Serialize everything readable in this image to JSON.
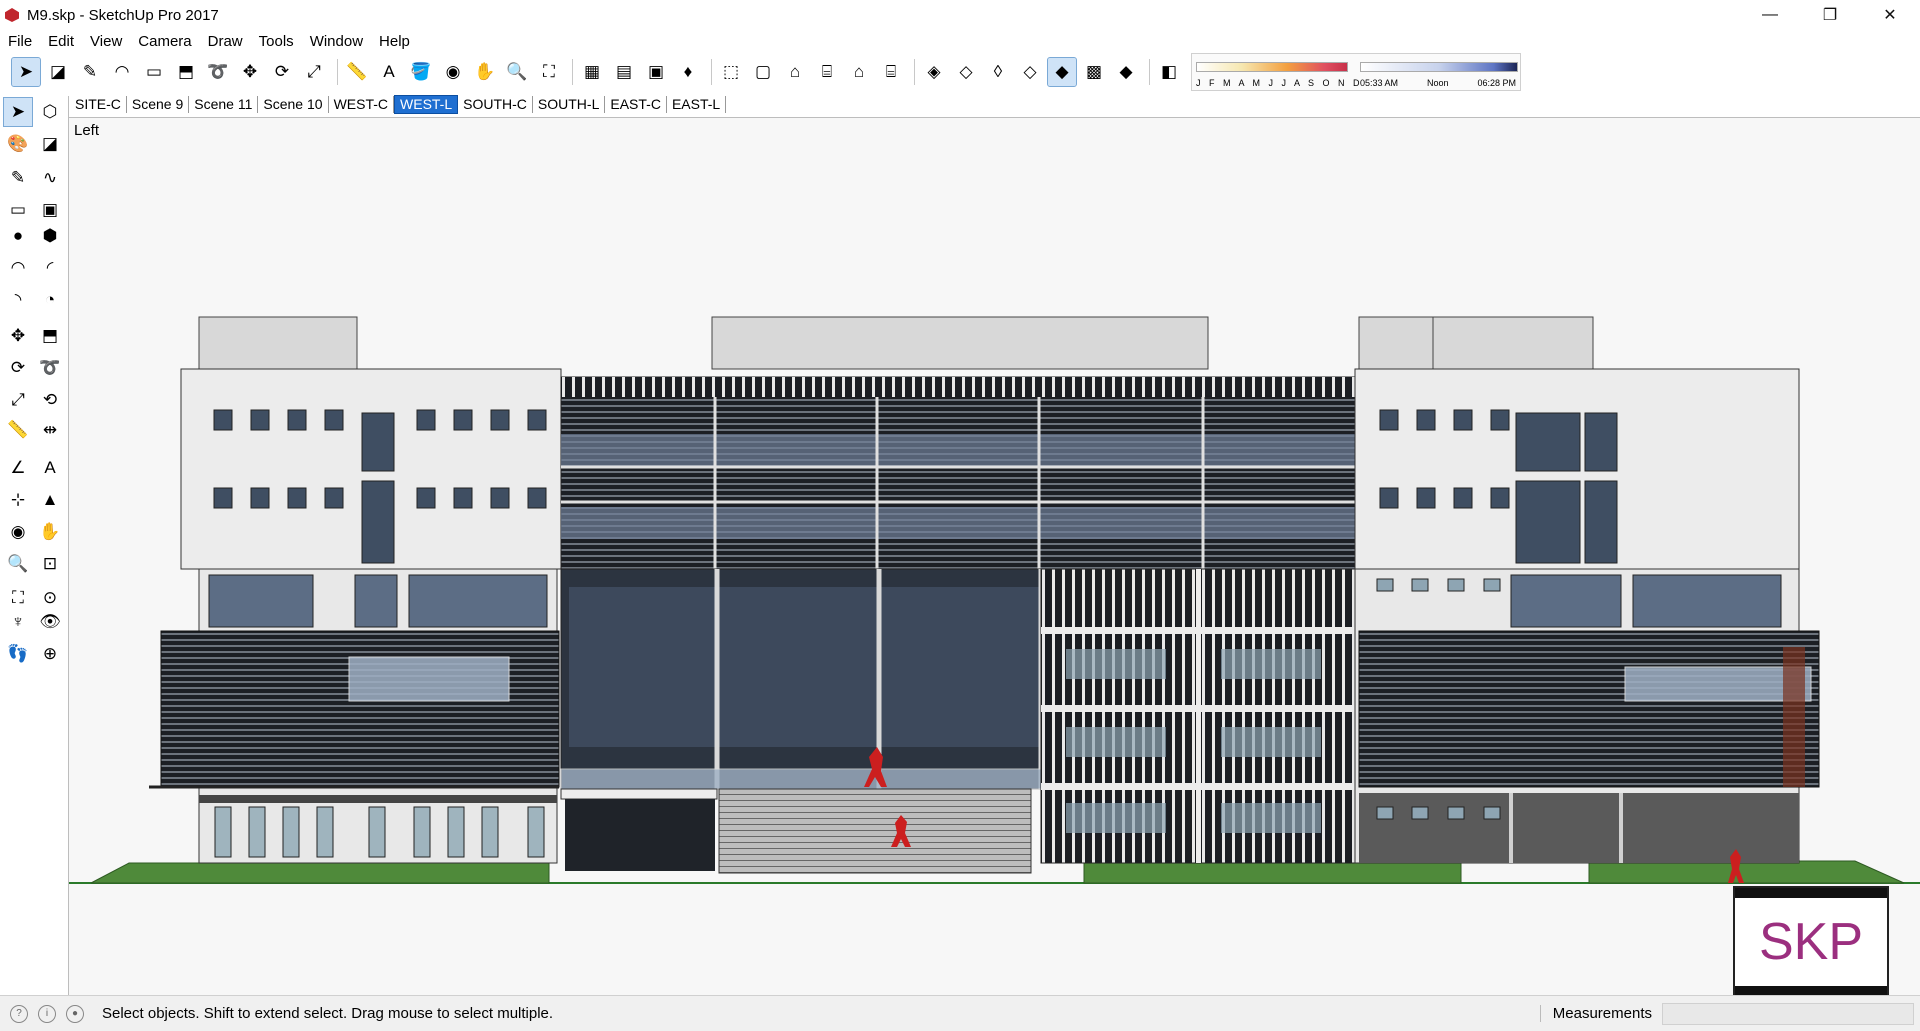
{
  "window": {
    "title": "M9.skp - SketchUp Pro 2017",
    "controls": {
      "minimize": "—",
      "maximize": "❐",
      "close": "✕"
    }
  },
  "menu": [
    "File",
    "Edit",
    "View",
    "Camera",
    "Draw",
    "Tools",
    "Window",
    "Help"
  ],
  "toolbar": {
    "tools": [
      {
        "name": "select-icon",
        "glyph": "➤",
        "active": true
      },
      {
        "name": "eraser-icon",
        "glyph": "◪"
      },
      {
        "name": "pencil-icon",
        "glyph": "✎"
      },
      {
        "name": "arc-icon",
        "glyph": "◠"
      },
      {
        "name": "rectangle-icon",
        "glyph": "▭"
      },
      {
        "name": "push-pull-icon",
        "glyph": "⬒"
      },
      {
        "name": "follow-me-icon",
        "glyph": "➰"
      },
      {
        "name": "move-icon",
        "glyph": "✥"
      },
      {
        "name": "rotate-icon",
        "glyph": "⟳"
      },
      {
        "name": "scale-icon",
        "glyph": "⤢"
      },
      {
        "name": "tape-measure-icon",
        "glyph": "📏"
      },
      {
        "name": "text-icon",
        "glyph": "A"
      },
      {
        "name": "paint-bucket-icon",
        "glyph": "🪣"
      },
      {
        "name": "orbit-icon",
        "glyph": "◉"
      },
      {
        "name": "pan-icon",
        "glyph": "✋"
      },
      {
        "name": "zoom-icon",
        "glyph": "🔍"
      },
      {
        "name": "zoom-extents-icon",
        "glyph": "⛶"
      },
      {
        "name": "warehouse-icon",
        "glyph": "▦"
      },
      {
        "name": "share-model-icon",
        "glyph": "▤"
      },
      {
        "name": "extension-warehouse-icon",
        "glyph": "▣"
      },
      {
        "name": "ruby-icon",
        "glyph": "♦"
      },
      {
        "name": "iso-view-icon",
        "glyph": "⬚"
      },
      {
        "name": "top-view-icon",
        "glyph": "▢"
      },
      {
        "name": "front-view-icon",
        "glyph": "⌂"
      },
      {
        "name": "right-view-icon",
        "glyph": "⌸"
      },
      {
        "name": "back-view-icon",
        "glyph": "⌂"
      },
      {
        "name": "left-view-icon",
        "glyph": "⌸"
      },
      {
        "name": "xray-icon",
        "glyph": "◈"
      },
      {
        "name": "back-edges-icon",
        "glyph": "◇"
      },
      {
        "name": "wireframe-icon",
        "glyph": "◊"
      },
      {
        "name": "hidden-line-icon",
        "glyph": "◇"
      },
      {
        "name": "shaded-icon",
        "glyph": "◆",
        "active": true
      },
      {
        "name": "shaded-textures-icon",
        "glyph": "▩"
      },
      {
        "name": "monochrome-icon",
        "glyph": "◆"
      },
      {
        "name": "shadows-icon",
        "glyph": "◧"
      }
    ],
    "shadow_months": "J F M A M J J A S O N D",
    "shadow_times": {
      "start": "05:33 AM",
      "mid": "Noon",
      "end": "06:28 PM"
    }
  },
  "left_toolbar": [
    {
      "name": "select-icon",
      "glyph": "➤",
      "active": true
    },
    {
      "name": "make-component-icon",
      "glyph": "⬡"
    },
    {
      "name": "paint-bucket-icon",
      "glyph": "🎨"
    },
    {
      "name": "eraser-icon",
      "glyph": "◪"
    },
    {
      "name": "line-icon",
      "glyph": "✎"
    },
    {
      "name": "freehand-icon",
      "glyph": "∿"
    },
    {
      "name": "rectangle-icon",
      "glyph": "▭"
    },
    {
      "name": "rotated-rectangle-icon",
      "glyph": "▣"
    },
    {
      "name": "circle-icon",
      "glyph": "●"
    },
    {
      "name": "polygon-icon",
      "glyph": "⬢"
    },
    {
      "name": "arc-icon",
      "glyph": "◠"
    },
    {
      "name": "two-point-arc-icon",
      "glyph": "◜"
    },
    {
      "name": "three-point-arc-icon",
      "glyph": "◝"
    },
    {
      "name": "pie-icon",
      "glyph": "◔"
    },
    {
      "name": "move-icon",
      "glyph": "✥"
    },
    {
      "name": "push-pull-icon",
      "glyph": "⬒"
    },
    {
      "name": "rotate-icon",
      "glyph": "⟳"
    },
    {
      "name": "follow-me-icon",
      "glyph": "➰"
    },
    {
      "name": "scale-icon",
      "glyph": "⤢"
    },
    {
      "name": "offset-icon",
      "glyph": "⟲"
    },
    {
      "name": "tape-measure-icon",
      "glyph": "📏"
    },
    {
      "name": "dimension-icon",
      "glyph": "⇹"
    },
    {
      "name": "protractor-icon",
      "glyph": "∠"
    },
    {
      "name": "text-icon",
      "glyph": "A"
    },
    {
      "name": "axes-icon",
      "glyph": "⊹"
    },
    {
      "name": "3d-text-icon",
      "glyph": "▲"
    },
    {
      "name": "orbit-icon",
      "glyph": "◉"
    },
    {
      "name": "pan-icon",
      "glyph": "✋"
    },
    {
      "name": "zoom-icon",
      "glyph": "🔍"
    },
    {
      "name": "zoom-window-icon",
      "glyph": "⊡"
    },
    {
      "name": "zoom-extents-icon",
      "glyph": "⛶"
    },
    {
      "name": "previous-view-icon",
      "glyph": "⊙"
    },
    {
      "name": "position-camera-icon",
      "glyph": "♆"
    },
    {
      "name": "look-around-icon",
      "glyph": "👁"
    },
    {
      "name": "walk-icon",
      "glyph": "👣"
    },
    {
      "name": "section-plane-icon",
      "glyph": "⊕"
    }
  ],
  "scenes": [
    "SITE-C",
    "Scene 9",
    "Scene 11",
    "Scene 10",
    "WEST-C",
    "WEST-L",
    "SOUTH-C",
    "SOUTH-L",
    "EAST-C",
    "EAST-L"
  ],
  "active_scene": "WEST-L",
  "view_label": "Left",
  "logo_text": "SKP",
  "status": {
    "message": "Select objects. Shift to extend select. Drag mouse to select multiple.",
    "measurements_label": "Measurements",
    "measurements_value": ""
  },
  "colors": {
    "accent": "#1f6fd1",
    "facade_white": "#ececec",
    "glass_dark": "#2c3440",
    "glass_blue": "#7e93b0",
    "lawn": "#4f8a3a",
    "figure_red": "#cc1f1f",
    "logo": "#9b2f7f"
  }
}
